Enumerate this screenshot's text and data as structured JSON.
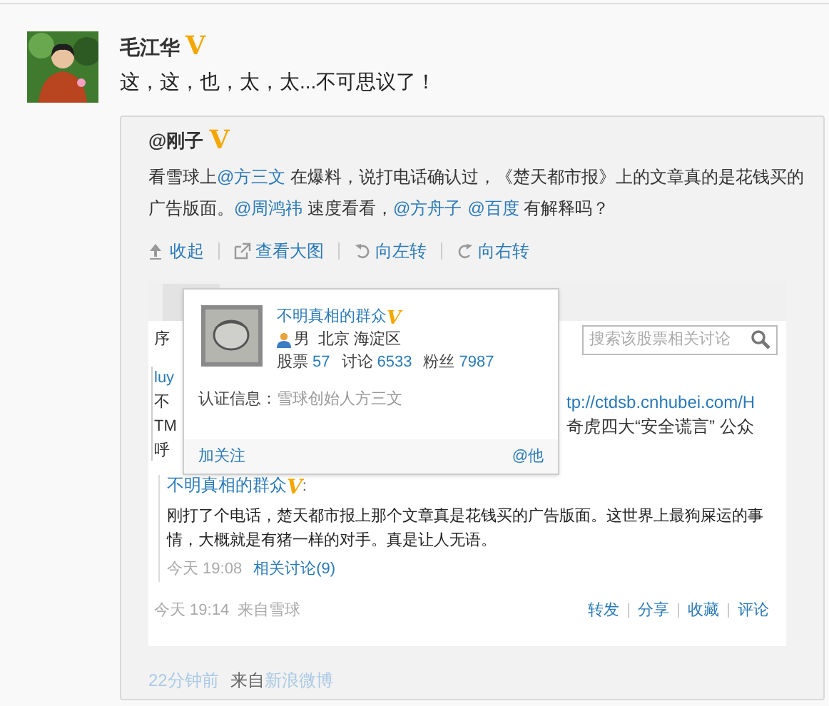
{
  "post": {
    "author": "毛江华",
    "badge": "V",
    "text": "这，这，也，太，太...不可思议了！"
  },
  "repost": {
    "author": "@刚子",
    "badge": "V",
    "segments": [
      {
        "kind": "plain",
        "text": "看雪球上"
      },
      {
        "kind": "link",
        "text": "@方三文"
      },
      {
        "kind": "plain",
        "text": " 在爆料，说打电话确认过，《楚天都市报》上的文章真的是花钱买的广告版面。"
      },
      {
        "kind": "link",
        "text": "@周鸿祎"
      },
      {
        "kind": "plain",
        "text": " 速度看看，"
      },
      {
        "kind": "link",
        "text": "@方舟子"
      },
      {
        "kind": "link",
        "text": "@百度"
      },
      {
        "kind": "plain",
        "text": " 有解释吗？"
      }
    ],
    "image_actions": [
      {
        "kind": "collapse",
        "label": "收起"
      },
      {
        "kind": "enlarge",
        "label": "查看大图"
      },
      {
        "kind": "rotate_left",
        "label": "向左转"
      },
      {
        "kind": "rotate_right",
        "label": "向右转"
      }
    ]
  },
  "screenshot": {
    "sort_label": "序",
    "search": {
      "placeholder": "搜索该股票相关讨论"
    },
    "left_fragments": [
      "luy",
      "不",
      "TM",
      "呼"
    ],
    "right_fragments": [
      "tp://ctdsb.cnhubei.com/H",
      "奇虎四大“安全谎言” 公众"
    ],
    "popup": {
      "name": "不明真相的群众",
      "badge": "V",
      "gender": "男",
      "location": "北京 海淀区",
      "stats": [
        {
          "label": "股票",
          "value": "57"
        },
        {
          "label": "讨论",
          "value": "6533"
        },
        {
          "label": "粉丝",
          "value": "7987"
        }
      ],
      "verification_label": "认证信息：",
      "verification": "雪球创始人方三文",
      "follow": "加关注",
      "mention": "@他"
    },
    "quote": {
      "author": "不明真相的群众",
      "badge": "V",
      "colon": ":",
      "text": "刚打了个电话，楚天都市报上那个文章真是花钱买的广告版面。这世界上最狗屎运的事情，大概就是有猪一样的对手。真是让人无语。",
      "time": "今天 19:08",
      "related": "相关讨论(9)"
    },
    "time": "今天 19:14",
    "source": "来自雪球",
    "actions": [
      "转发",
      "分享",
      "收藏",
      "评论"
    ]
  },
  "footer": {
    "time": "22分钟前",
    "source_prefix": "来自",
    "source": "新浪微博"
  }
}
